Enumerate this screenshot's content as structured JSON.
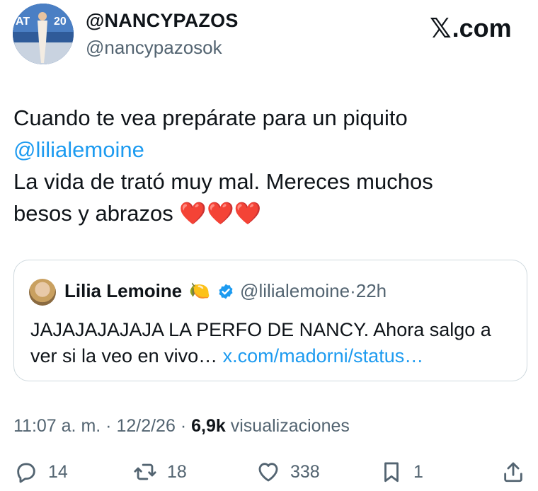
{
  "author": {
    "display_name": "@NANCYPAZOS",
    "handle": "@nancypazosok",
    "avatar_icon": "profile-photo"
  },
  "brand": {
    "x_glyph": "𝕏",
    "suffix": ".com"
  },
  "tweet": {
    "line1": "Cuando te vea prepárate para un piquito",
    "mention": "@lilialemoine",
    "line3": "La vida de trató muy mal. Mereces muchos",
    "line4": "besos y abrazos",
    "hearts": "❤️❤️❤️"
  },
  "quote": {
    "name": "Lilia Lemoine",
    "emoji": "🍋",
    "handle": "@lilialemoine",
    "separator": "·",
    "time": "22h",
    "line1": "JAJAJAJAJAJA LA PERFO DE NANCY. Ahora salgo a",
    "line2_text": "ver si la veo en vivo…",
    "line2_link": "x.com/madorni/status…"
  },
  "meta": {
    "time": "11:07 a. m.",
    "sep1": "·",
    "date": "12/2/26",
    "sep2": "·",
    "views_count": "6,9k",
    "views_label": "visualizaciones"
  },
  "actions": {
    "replies": "14",
    "reposts": "18",
    "likes": "338",
    "bookmarks": "1"
  },
  "colors": {
    "accent": "#1d9bf0",
    "muted": "#536471",
    "text": "#0f1419",
    "border": "#cfd9de"
  }
}
